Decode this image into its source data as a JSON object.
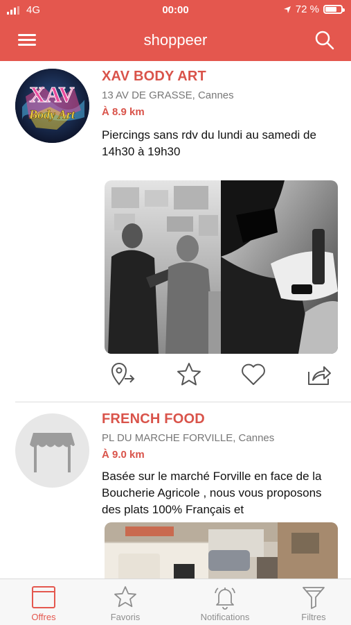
{
  "status_bar": {
    "carrier": "4G",
    "time": "00:00",
    "battery_percent": "72 %",
    "battery_level": 0.72
  },
  "header": {
    "title": "shoppeer",
    "menu_icon": "hamburger-menu-icon",
    "search_icon": "search-icon"
  },
  "shops": [
    {
      "name": "XAV BODY ART",
      "address": "13 AV DE GRASSE, Cannes",
      "distance": "À 8.9 km",
      "description": "Piercings sans rdv du lundi au samedi de 14h30 à 19h30",
      "logo_text": [
        "XAV",
        "Body Art"
      ]
    },
    {
      "name": "FRENCH FOOD",
      "address": "PL DU MARCHE FORVILLE, Cannes",
      "distance": "À 9.0 km",
      "description": "Basée sur le marché Forville en face de la Boucherie Agricole , nous vous proposons des plats 100% Français et"
    }
  ],
  "actions": [
    "directions-icon",
    "star-icon",
    "heart-icon",
    "share-icon"
  ],
  "tabs": [
    {
      "label": "Offres",
      "icon": "offers-icon",
      "active": true
    },
    {
      "label": "Favoris",
      "icon": "star-icon",
      "active": false
    },
    {
      "label": "Notifications",
      "icon": "bell-icon",
      "active": false
    },
    {
      "label": "Filtres",
      "icon": "filter-icon",
      "active": false
    }
  ],
  "colors": {
    "brand": "#e4574e",
    "name_red": "#d9534a",
    "tab_inactive": "#8e8e8e"
  }
}
